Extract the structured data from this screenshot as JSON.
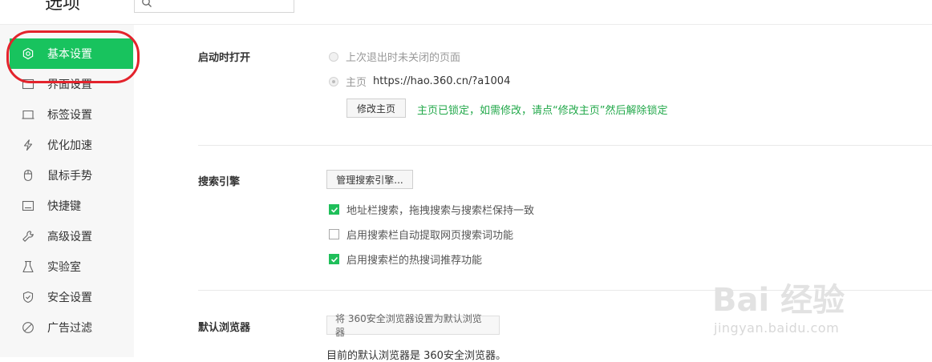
{
  "header": {
    "title": "选项",
    "search_placeholder": ""
  },
  "sidebar": {
    "items": [
      {
        "label": "基本设置",
        "icon": "settings-icon",
        "active": true
      },
      {
        "label": "界面设置",
        "icon": "interface-icon"
      },
      {
        "label": "标签设置",
        "icon": "tab-icon"
      },
      {
        "label": "优化加速",
        "icon": "lightning-icon"
      },
      {
        "label": "鼠标手势",
        "icon": "mouse-icon"
      },
      {
        "label": "快捷键",
        "icon": "shortcut-icon"
      },
      {
        "label": "高级设置",
        "icon": "wrench-icon"
      },
      {
        "label": "实验室",
        "icon": "flask-icon"
      },
      {
        "label": "安全设置",
        "icon": "shield-icon"
      },
      {
        "label": "广告过滤",
        "icon": "block-icon"
      }
    ]
  },
  "startup": {
    "label": "启动时打开",
    "option_last": "上次退出时未关闭的页面",
    "option_home_label": "主页",
    "option_home_url": "https://hao.360.cn/?a1004",
    "modify_button": "修改主页",
    "lock_hint": "主页已锁定，如需修改，请点“修改主页”然后解除锁定"
  },
  "search_engine": {
    "label": "搜索引擎",
    "manage_button": "管理搜索引擎...",
    "options": [
      {
        "label": "地址栏搜索，拖拽搜索与搜索栏保持一致",
        "checked": true
      },
      {
        "label": "启用搜索栏自动提取网页搜索词功能",
        "checked": false
      },
      {
        "label": "启用搜索栏的热搜词推荐功能",
        "checked": true
      }
    ]
  },
  "default_browser": {
    "label": "默认浏览器",
    "set_button": "将 360安全浏览器设置为默认浏览器",
    "status_text": "目前的默认浏览器是 360安全浏览器。"
  },
  "watermark": {
    "main": "Bai 经验",
    "sub": "jingyan.baidu.com"
  },
  "colors": {
    "accent": "#18c35e",
    "hint": "#22a84a",
    "annotation": "#e3232c"
  }
}
